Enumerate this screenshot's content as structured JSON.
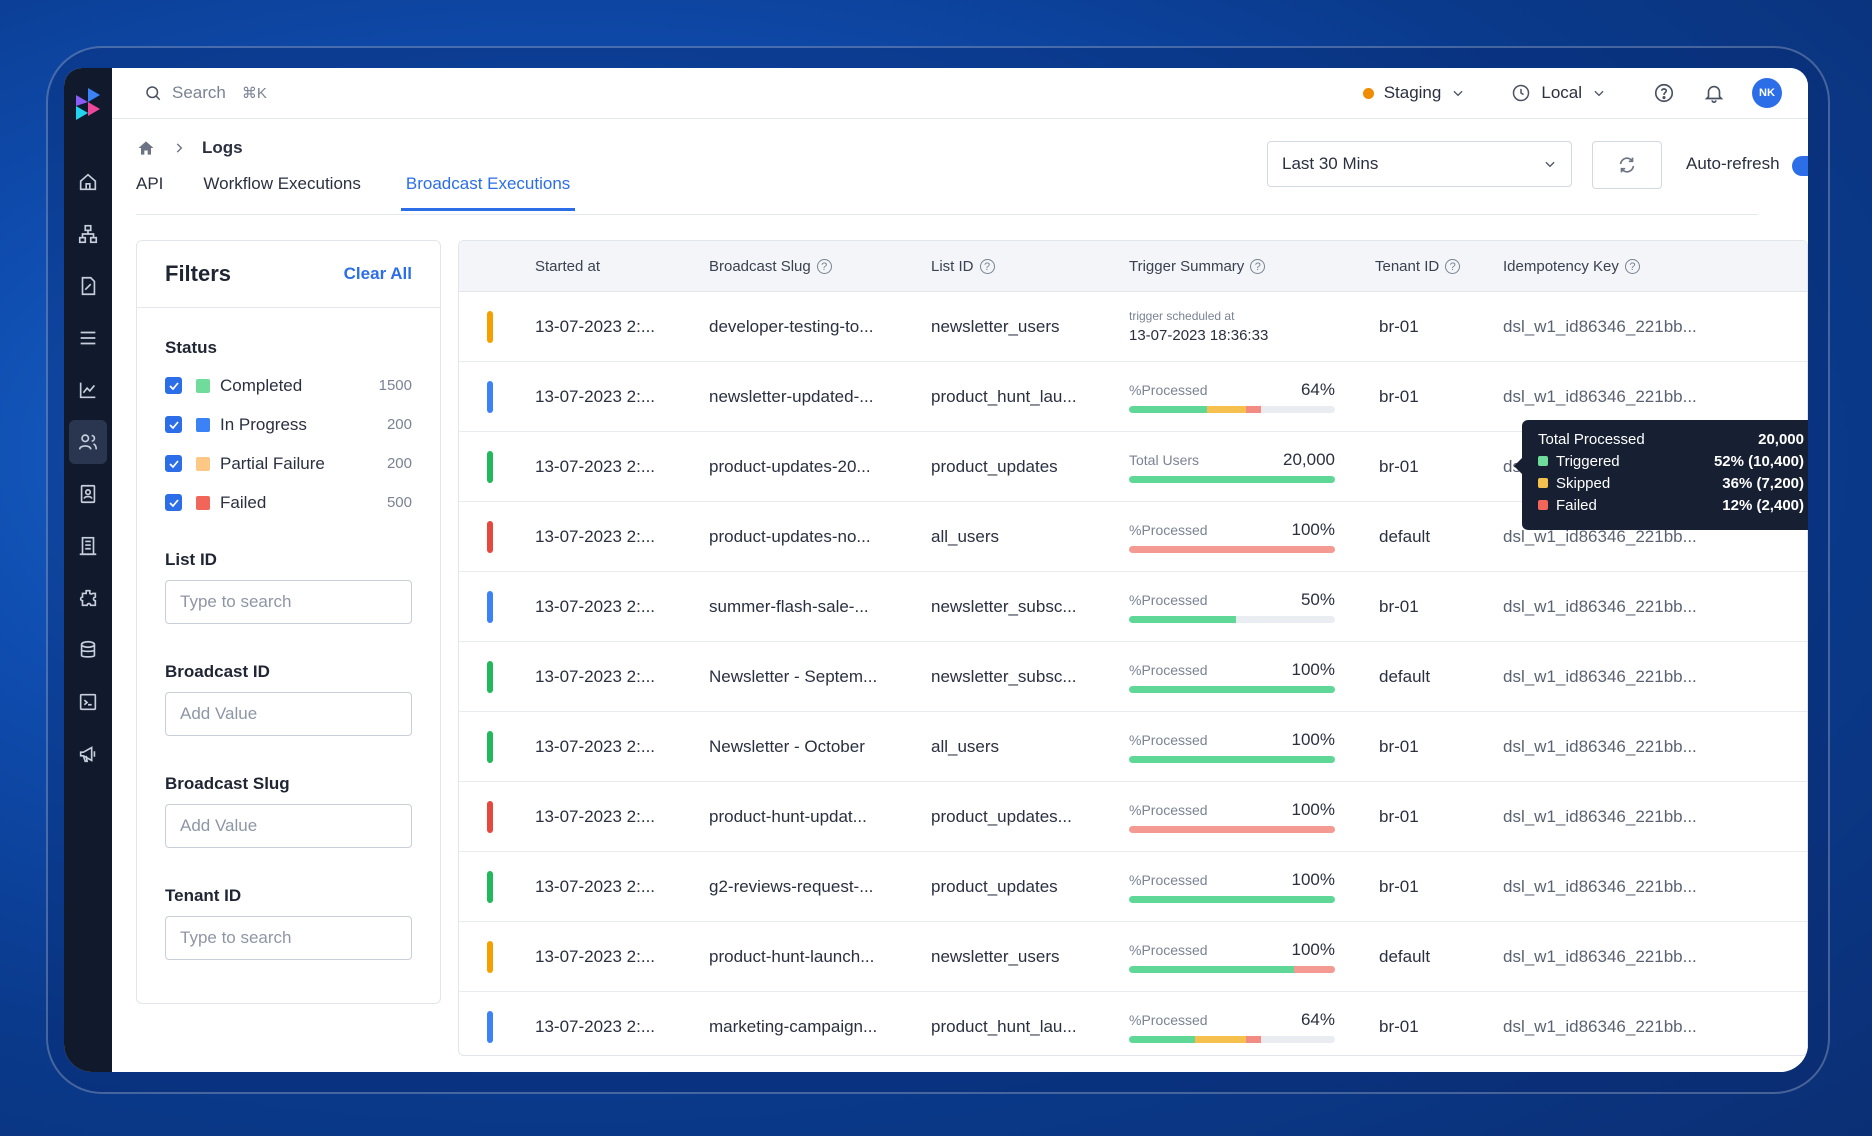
{
  "topbar": {
    "search_placeholder": "Search",
    "search_shortcut": "⌘K",
    "environment": "Staging",
    "timezone": "Local",
    "avatar_initials": "NK"
  },
  "breadcrumb": {
    "current": "Logs"
  },
  "tabs": [
    {
      "label": "API",
      "active": false
    },
    {
      "label": "Workflow Executions",
      "active": false
    },
    {
      "label": "Broadcast Executions",
      "active": true
    }
  ],
  "controls": {
    "time_range": "Last 30 Mins",
    "auto_refresh_label": "Auto-refresh",
    "auto_refresh_on": true
  },
  "filters": {
    "title": "Filters",
    "clear_label": "Clear All",
    "status_title": "Status",
    "statuses": [
      {
        "label": "Completed",
        "count": "1500",
        "color": "#6fdc9c",
        "checked": true
      },
      {
        "label": "In Progress",
        "count": "200",
        "color": "#3b82f6",
        "checked": true
      },
      {
        "label": "Partial Failure",
        "count": "200",
        "color": "#fcc883",
        "checked": true
      },
      {
        "label": "Failed",
        "count": "500",
        "color": "#f2665a",
        "checked": true
      }
    ],
    "list_id": {
      "title": "List ID",
      "placeholder": "Type to search"
    },
    "broadcast_id": {
      "title": "Broadcast ID",
      "placeholder": "Add Value"
    },
    "broadcast_slug": {
      "title": "Broadcast Slug",
      "placeholder": "Add Value"
    },
    "tenant_id": {
      "title": "Tenant ID",
      "placeholder": "Type to search"
    }
  },
  "table": {
    "headers": {
      "started_at": "Started at",
      "slug": "Broadcast Slug",
      "list_id": "List ID",
      "trigger_summary": "Trigger Summary",
      "tenant_id": "Tenant ID",
      "idempotency": "Idempotency Key"
    },
    "rows": [
      {
        "status_color": "#f59f00",
        "started": "13-07-2023 2:...",
        "slug": "developer-testing-to...",
        "list": "newsletter_users",
        "summary_type": "scheduled",
        "sched_label": "trigger scheduled at",
        "sched_value": "13-07-2023 18:36:33",
        "tenant": "br-01",
        "key": "dsl_w1_id86346_221bb..."
      },
      {
        "status_color": "#3b82f6",
        "started": "13-07-2023 2:...",
        "slug": "newsletter-updated-...",
        "list": "product_hunt_lau...",
        "summary_type": "progress",
        "label": "%Processed",
        "value": "64%",
        "segments": [
          {
            "color": "#5fd897",
            "pct": 38
          },
          {
            "color": "#f5c04d",
            "pct": 19
          },
          {
            "color": "#f28b82",
            "pct": 7
          }
        ],
        "tenant": "br-01",
        "key": "dsl_w1_id86346_221bb..."
      },
      {
        "status_color": "#22b85c",
        "started": "13-07-2023 2:...",
        "slug": "product-updates-20...",
        "list": "product_updates",
        "summary_type": "progress",
        "label": "Total Users",
        "value": "20,000",
        "segments": [
          {
            "color": "#5fd897",
            "pct": 100
          }
        ],
        "tenant": "br-01",
        "key": "dsl_w1_id86346_221bb..."
      },
      {
        "status_color": "#e5483d",
        "started": "13-07-2023 2:...",
        "slug": "product-updates-no...",
        "list": "all_users",
        "summary_type": "progress",
        "label": "%Processed",
        "value": "100%",
        "segments": [
          {
            "color": "#f49a92",
            "pct": 100
          }
        ],
        "tenant": "default",
        "key": "dsl_w1_id86346_221bb..."
      },
      {
        "status_color": "#3b82f6",
        "started": "13-07-2023 2:...",
        "slug": "summer-flash-sale-...",
        "list": "newsletter_subsc...",
        "summary_type": "progress",
        "label": "%Processed",
        "value": "50%",
        "segments": [
          {
            "color": "#5fd897",
            "pct": 52
          }
        ],
        "tenant": "br-01",
        "key": "dsl_w1_id86346_221bb..."
      },
      {
        "status_color": "#22b85c",
        "started": "13-07-2023 2:...",
        "slug": "Newsletter - Septem...",
        "list": "newsletter_subsc...",
        "summary_type": "progress",
        "label": "%Processed",
        "value": "100%",
        "segments": [
          {
            "color": "#5fd897",
            "pct": 100
          }
        ],
        "tenant": "default",
        "key": "dsl_w1_id86346_221bb..."
      },
      {
        "status_color": "#22b85c",
        "started": "13-07-2023 2:...",
        "slug": "Newsletter - October",
        "list": "all_users",
        "summary_type": "progress",
        "label": "%Processed",
        "value": "100%",
        "segments": [
          {
            "color": "#5fd897",
            "pct": 100
          }
        ],
        "tenant": "br-01",
        "key": "dsl_w1_id86346_221bb..."
      },
      {
        "status_color": "#e5483d",
        "started": "13-07-2023 2:...",
        "slug": "product-hunt-updat...",
        "list": "product_updates...",
        "summary_type": "progress",
        "label": "%Processed",
        "value": "100%",
        "segments": [
          {
            "color": "#f49a92",
            "pct": 100
          }
        ],
        "tenant": "br-01",
        "key": "dsl_w1_id86346_221bb..."
      },
      {
        "status_color": "#22b85c",
        "started": "13-07-2023 2:...",
        "slug": "g2-reviews-request-...",
        "list": "product_updates",
        "summary_type": "progress",
        "label": "%Processed",
        "value": "100%",
        "segments": [
          {
            "color": "#5fd897",
            "pct": 100
          }
        ],
        "tenant": "br-01",
        "key": "dsl_w1_id86346_221bb..."
      },
      {
        "status_color": "#f59f00",
        "started": "13-07-2023 2:...",
        "slug": "product-hunt-launch...",
        "list": "newsletter_users",
        "summary_type": "progress",
        "label": "%Processed",
        "value": "100%",
        "segments": [
          {
            "color": "#5fd897",
            "pct": 80
          },
          {
            "color": "#f49a92",
            "pct": 20
          }
        ],
        "tenant": "default",
        "key": "dsl_w1_id86346_221bb..."
      },
      {
        "status_color": "#3b82f6",
        "started": "13-07-2023 2:...",
        "slug": "marketing-campaign...",
        "list": "product_hunt_lau...",
        "summary_type": "progress",
        "label": "%Processed",
        "value": "64%",
        "segments": [
          {
            "color": "#5fd897",
            "pct": 32
          },
          {
            "color": "#f5c04d",
            "pct": 25
          },
          {
            "color": "#f28b82",
            "pct": 7
          }
        ],
        "tenant": "br-01",
        "key": "dsl_w1_id86346_221bb..."
      }
    ]
  },
  "tooltip": {
    "total_label": "Total Processed",
    "total_value": "20,000",
    "items": [
      {
        "label": "Triggered",
        "value": "52% (10,400)",
        "color": "#6fdc9c"
      },
      {
        "label": "Skipped",
        "value": "36% (7,200)",
        "color": "#f5c04d"
      },
      {
        "label": "Failed",
        "value": "12% (2,400)",
        "color": "#f2665a"
      }
    ]
  },
  "sidebar": {
    "items": [
      {
        "icon": "home-icon"
      },
      {
        "icon": "workflow-icon"
      },
      {
        "icon": "template-icon"
      },
      {
        "icon": "list-icon"
      },
      {
        "icon": "analytics-icon"
      },
      {
        "icon": "users-icon",
        "active": true
      },
      {
        "icon": "contact-icon"
      },
      {
        "icon": "building-icon"
      },
      {
        "icon": "integrations-icon"
      },
      {
        "icon": "database-icon"
      },
      {
        "icon": "terminal-icon"
      },
      {
        "icon": "megaphone-icon"
      }
    ]
  }
}
